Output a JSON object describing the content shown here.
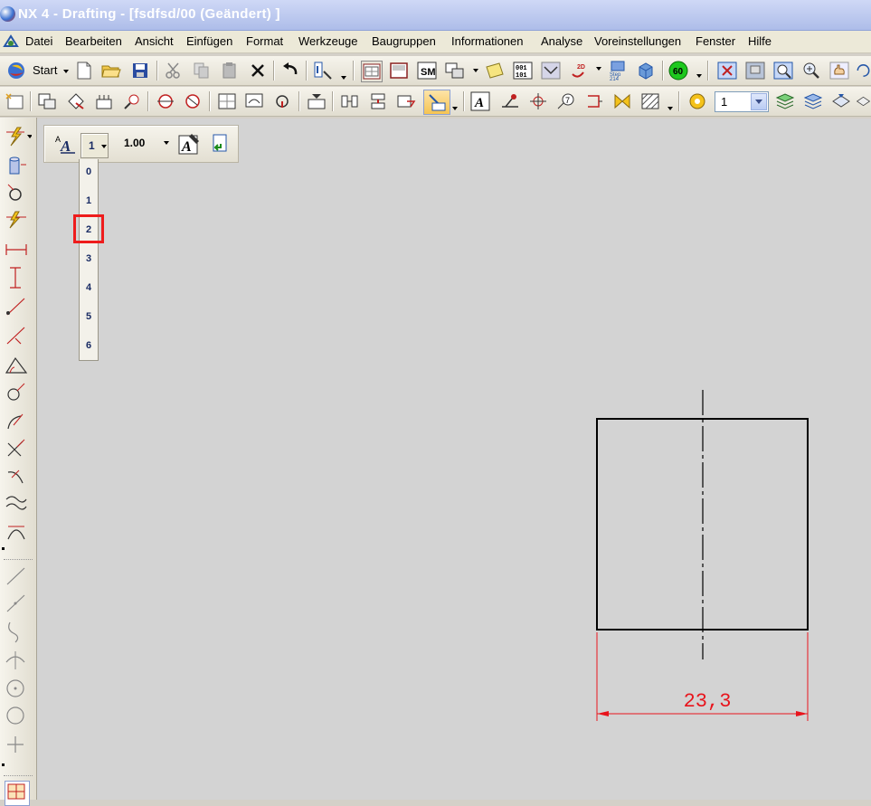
{
  "window": {
    "title": "NX 4 - Drafting - [fsdfsd/00 (Geändert) ]"
  },
  "menu": [
    "Datei",
    "Bearbeiten",
    "Ansicht",
    "Einfügen",
    "Format",
    "Werkzeuge",
    "Baugruppen",
    "Informationen",
    "Analyse",
    "Voreinstellungen",
    "Fenster",
    "Hilfe"
  ],
  "toolbar": {
    "start_label": "Start",
    "layer_value": "1"
  },
  "text_toolbar": {
    "size_value": "1",
    "scale_value": "1.00",
    "size_options": [
      "0",
      "1",
      "2",
      "3",
      "4",
      "5",
      "6"
    ],
    "highlighted_option": "2"
  },
  "drawing": {
    "dimension_text": "23,3"
  },
  "colors": {
    "dimension": "#e8141c",
    "highlight": "#ee1c1c",
    "canvas": "#d3d3d3"
  }
}
